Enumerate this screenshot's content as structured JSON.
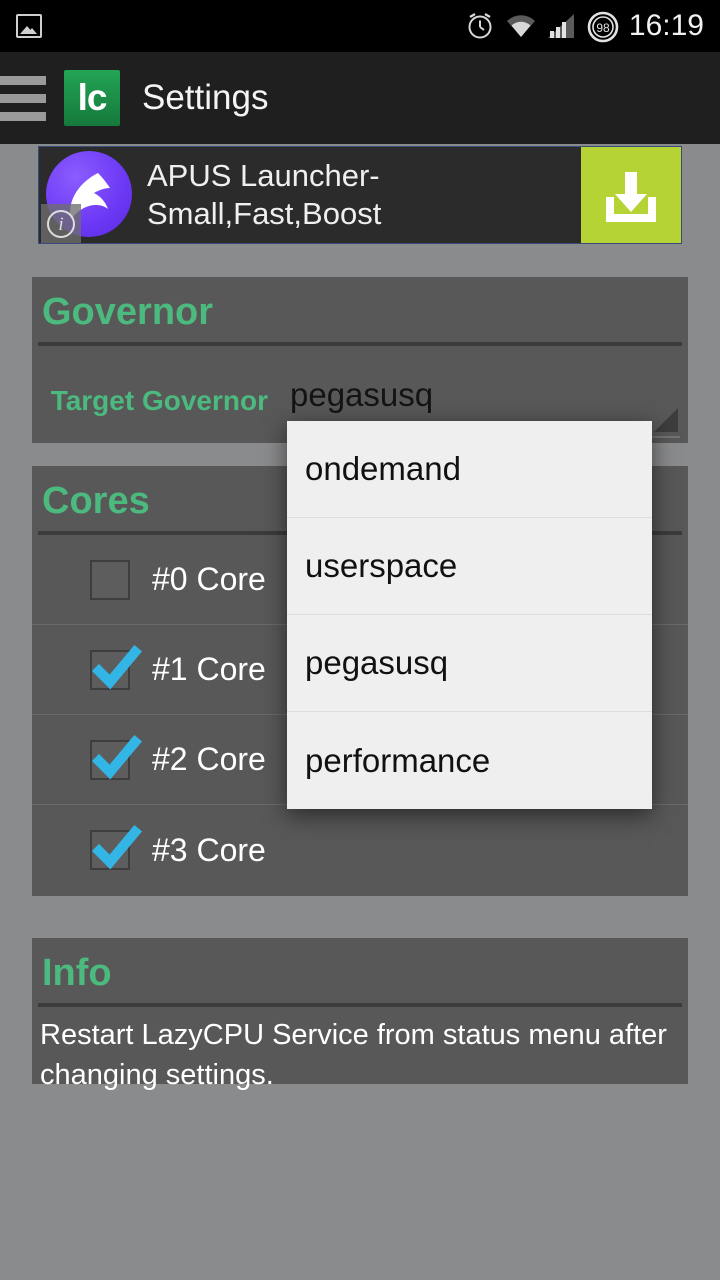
{
  "statusbar": {
    "time": "16:19",
    "battery_percent": "98",
    "icons": [
      "photo-icon",
      "alarm-icon",
      "wifi-icon",
      "signal-icon",
      "battery-icon"
    ]
  },
  "actionbar": {
    "drawer_icon": "hamburger-menu-icon",
    "app_icon_text": "lc",
    "app_icon_color": "#1d9a4e",
    "title": "Settings"
  },
  "ad": {
    "icon": "apus-launcher-icon",
    "info_badge": "i",
    "headline_line1": "APUS Launcher-",
    "headline_line2": "Small,Fast,Boost",
    "cta_icon": "download-icon",
    "cta_color": "#b5d334"
  },
  "governor": {
    "title": "Governor",
    "label": "Target Governor",
    "selected": "pegasusq",
    "accent": "#4cb97e"
  },
  "dropdown": {
    "open": true,
    "options": [
      {
        "label": "ondemand"
      },
      {
        "label": "userspace"
      },
      {
        "label": "pegasusq"
      },
      {
        "label": "performance"
      }
    ]
  },
  "cores": {
    "title": "Cores",
    "items": [
      {
        "label": "#0 Core",
        "checked": false
      },
      {
        "label": "#1 Core",
        "checked": true
      },
      {
        "label": "#2 Core",
        "checked": true
      },
      {
        "label": "#3 Core",
        "checked": true
      }
    ],
    "check_color": "#33b5e5"
  },
  "info": {
    "title": "Info",
    "text": "Restart LazyCPU Service from status menu after changing settings."
  },
  "theme": {
    "page_bg": "#8a8b8c",
    "card_bg": "#585858",
    "accent_green": "#4cb97e",
    "actionbar_bg": "#1f1f1f"
  }
}
